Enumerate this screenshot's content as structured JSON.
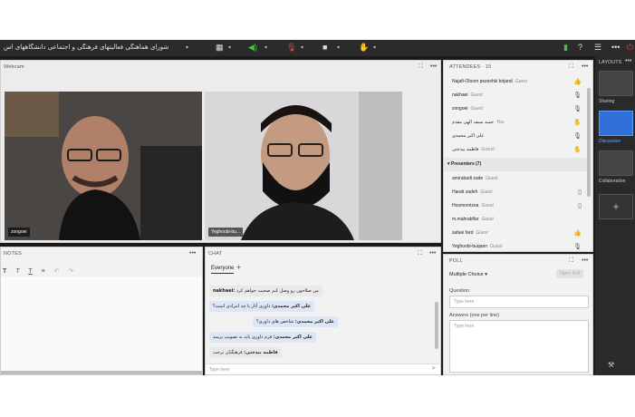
{
  "topbar": {
    "title": "شورای هماهنگی فعالیتهای فرهنگی و اجتماعی دانشگاههای اس",
    "icons": [
      "grid-icon",
      "speaker-icon",
      "mic-muted-icon",
      "camera-icon",
      "raise-hand-icon",
      "signal-icon",
      "help-icon",
      "more-icon",
      "power-icon"
    ]
  },
  "webcam": {
    "title": "Webcam",
    "left_name": "zongoei",
    "right_name": "Yeghoobi-bu..."
  },
  "attendees": {
    "title": "ATTENDEES · 15",
    "hosts": [
      {
        "name": "Najafi-Oloom pezeshki birjand",
        "role": "Guest",
        "icon": "thumbs-up-icon"
      },
      {
        "name": "nakhaei",
        "role": "Guest",
        "icon": "mic-muted-icon"
      },
      {
        "name": "zongoei",
        "role": "Guest",
        "icon": "mic-icon"
      },
      {
        "name": "حمید سیف الهی مقدم",
        "role": "You",
        "icon": "hand-icon"
      },
      {
        "name": "علی اکبر محمدی",
        "role": "",
        "icon": "mic-muted-icon"
      },
      {
        "name": "فاطمه بیدختی",
        "role": "Guest",
        "icon": "hand-icon"
      }
    ],
    "presenters_title": "Presenters (7)",
    "presenters": [
      {
        "name": "amirabadi zade",
        "role": "Guest",
        "icon": ""
      },
      {
        "name": "Harati zadeh",
        "role": "Guest",
        "icon": "phone-icon"
      },
      {
        "name": "Hosmonrizea",
        "role": "Guest",
        "icon": "phone-icon"
      },
      {
        "name": "m.mahrabifar",
        "role": "Guest",
        "icon": ""
      },
      {
        "name": "safaei fard",
        "role": "Guest",
        "icon": "thumbs-up-icon"
      },
      {
        "name": "Yeghoobi-buqaen",
        "role": "Guest",
        "icon": "mic-icon"
      }
    ]
  },
  "notes": {
    "title": "NOTES",
    "toolbar": [
      "T",
      "T",
      "T",
      "≡",
      "↶",
      "↷"
    ]
  },
  "chat": {
    "title": "CHAT",
    "tab": "Everyone",
    "add": "+",
    "messages": [
      {
        "author": "nakhaei:",
        "text": "من صلاحون رو وصل کنم صحبت خواهم کرد"
      },
      {
        "author": "علی اکبر محمدی:",
        "text": "داوری آثار با چه امرادی است؟"
      },
      {
        "author": "علی اکبر محمدی:",
        "text": "شاخص های داوری؟"
      },
      {
        "author": "علی اکبر محمدی:",
        "text": "فرم داوری باید به تصویب برسد"
      },
      {
        "author": "فاطمه بیدختی:",
        "text": "فرهنگیان نرجت"
      }
    ],
    "input_placeholder": "Type here"
  },
  "poll": {
    "title": "POLL",
    "type": "Multiple Choice",
    "open_button": "Open Poll",
    "question_label": "Question",
    "question_placeholder": "Type here",
    "answers_label": "Answers (one per line)",
    "answers_placeholder": "Type here"
  },
  "layouts": {
    "title": "LAYOUTS",
    "items": [
      "Sharing",
      "Discussion",
      "Collaboration"
    ],
    "add": "+"
  }
}
